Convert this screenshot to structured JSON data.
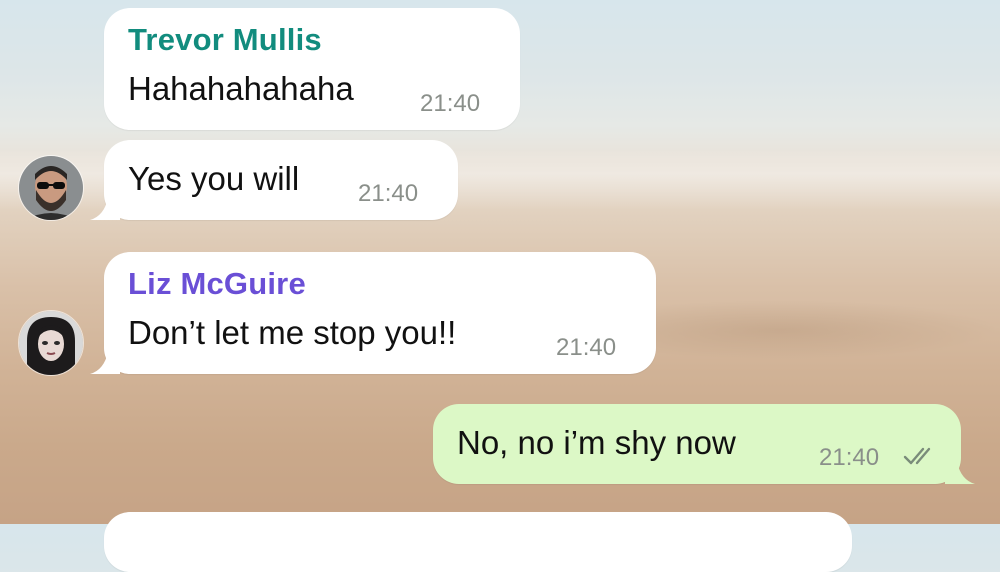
{
  "messages": [
    {
      "direction": "in",
      "sender": "Trevor Mullis",
      "sender_color": "#128c7e",
      "text": "Hahahahahaha",
      "time": "21:40"
    },
    {
      "direction": "in",
      "text": "Yes you will",
      "time": "21:40",
      "avatar_icon": "bearded-man-sunglasses-avatar"
    },
    {
      "direction": "in",
      "sender": "Liz McGuire",
      "sender_color": "#6a4fd6",
      "text": "Don’t let me stop you!!",
      "time": "21:40",
      "avatar_icon": "dark-haired-woman-avatar"
    },
    {
      "direction": "out",
      "text": "No, no i’m shy now",
      "time": "21:40",
      "status_icon": "double-check-icon",
      "bubble_color": "#dcf8c6"
    }
  ]
}
